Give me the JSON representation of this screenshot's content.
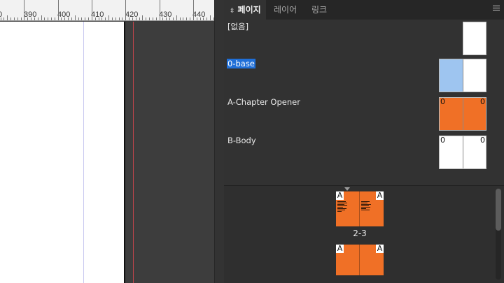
{
  "ruler": {
    "labels": [
      "0",
      "390",
      "400",
      "410",
      "420",
      "430",
      "440"
    ]
  },
  "panel": {
    "tabs": [
      {
        "label": "페이지",
        "active": true
      },
      {
        "label": "레이어",
        "active": false
      },
      {
        "label": "링크",
        "active": false
      }
    ],
    "menu_icon": "hamburger-menu-icon"
  },
  "masters": [
    {
      "label": "[없음]",
      "selected": false,
      "thumb": "white",
      "letters": []
    },
    {
      "label": "0-base",
      "selected": true,
      "thumb": "blue",
      "letters": []
    },
    {
      "label": "A-Chapter Opener",
      "selected": false,
      "thumb": "orange",
      "letters": [
        "0",
        "0"
      ]
    },
    {
      "label": "B-Body",
      "selected": false,
      "thumb": "white",
      "letters": [
        "0",
        "0"
      ]
    }
  ],
  "pages": {
    "spreads": [
      {
        "label": "2-3",
        "left_master": "A",
        "right_master": "A"
      },
      {
        "label": "",
        "left_master": "A",
        "right_master": "A"
      }
    ]
  },
  "colors": {
    "accent_selection": "#1f6fd8",
    "master_orange": "#f07026",
    "master_blue": "#9ec5f0",
    "panel_bg": "#323232"
  }
}
